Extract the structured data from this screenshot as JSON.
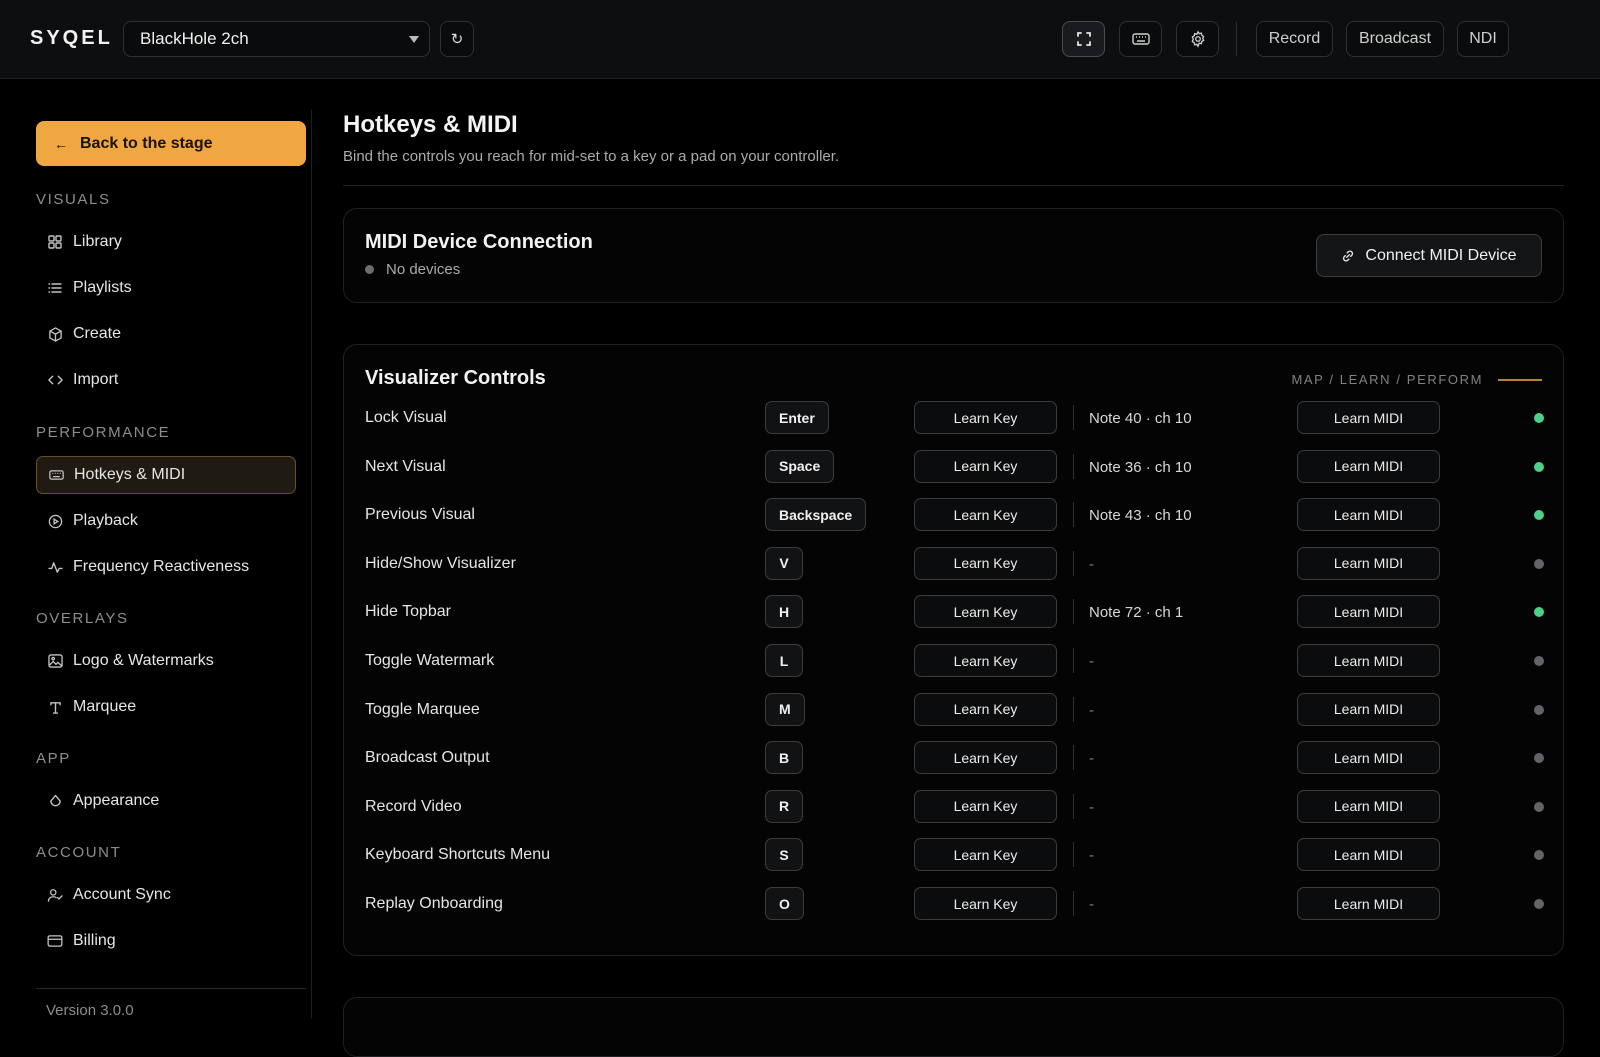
{
  "topbar": {
    "brand": "SYQEL",
    "device": "BlackHole 2ch",
    "refresh_glyph": "↻",
    "icons": [
      "fullscreen-icon",
      "keyboard-icon",
      "gear-icon"
    ],
    "buttons": [
      "Record",
      "Broadcast",
      "NDI"
    ]
  },
  "sidebar": {
    "back_label": "Back to the stage",
    "sections": [
      {
        "label": "VISUALS",
        "items": [
          {
            "label": "Library",
            "icon": "grid-icon"
          },
          {
            "label": "Playlists",
            "icon": "list-icon"
          },
          {
            "label": "Create",
            "icon": "cube-icon"
          },
          {
            "label": "Import",
            "icon": "code-icon"
          }
        ]
      },
      {
        "label": "PERFORMANCE",
        "items": [
          {
            "label": "Hotkeys & MIDI",
            "icon": "keyboard-icon",
            "active": true
          },
          {
            "label": "Playback",
            "icon": "play-circle-icon"
          },
          {
            "label": "Frequency Reactiveness",
            "icon": "pulse-icon"
          }
        ]
      },
      {
        "label": "OVERLAYS",
        "items": [
          {
            "label": "Logo & Watermarks",
            "icon": "image-icon"
          },
          {
            "label": "Marquee",
            "icon": "text-icon"
          }
        ]
      },
      {
        "label": "APP",
        "items": [
          {
            "label": "Appearance",
            "icon": "drop-icon"
          }
        ]
      },
      {
        "label": "ACCOUNT",
        "items": [
          {
            "label": "Account Sync",
            "icon": "user-sync-icon"
          },
          {
            "label": "Billing",
            "icon": "card-icon"
          }
        ]
      }
    ],
    "version": "Version 3.0.0"
  },
  "main": {
    "title": "Hotkeys & MIDI",
    "subtitle": "Bind the controls you reach for mid-set to a key or a pad on your controller.",
    "midi_card": {
      "title": "MIDI Device Connection",
      "status": "No devices",
      "connect_label": "Connect MIDI Device"
    },
    "controls_card": {
      "title": "Visualizer Controls",
      "tag": "MAP / LEARN / PERFORM",
      "learn_key_label": "Learn Key",
      "learn_midi_label": "Learn MIDI",
      "rows": [
        {
          "label": "Lock Visual",
          "key": "Enter",
          "midi": "Note 40 · ch 10",
          "mapped": true
        },
        {
          "label": "Next Visual",
          "key": "Space",
          "midi": "Note 36 · ch 10",
          "mapped": true
        },
        {
          "label": "Previous Visual",
          "key": "Backspace",
          "midi": "Note 43 · ch 10",
          "mapped": true
        },
        {
          "label": "Hide/Show Visualizer",
          "key": "V",
          "midi": "-",
          "mapped": false
        },
        {
          "label": "Hide Topbar",
          "key": "H",
          "midi": "Note 72 · ch 1",
          "mapped": true
        },
        {
          "label": "Toggle Watermark",
          "key": "L",
          "midi": "-",
          "mapped": false
        },
        {
          "label": "Toggle Marquee",
          "key": "M",
          "midi": "-",
          "mapped": false
        },
        {
          "label": "Broadcast Output",
          "key": "B",
          "midi": "-",
          "mapped": false
        },
        {
          "label": "Record Video",
          "key": "R",
          "midi": "-",
          "mapped": false
        },
        {
          "label": "Keyboard Shortcuts Menu",
          "key": "S",
          "midi": "-",
          "mapped": false
        },
        {
          "label": "Replay Onboarding",
          "key": "O",
          "midi": "-",
          "mapped": false
        }
      ]
    }
  },
  "colors": {
    "accent": "#f0a742",
    "mapped_dot": "#4fd089",
    "unmapped_dot": "#626467"
  }
}
